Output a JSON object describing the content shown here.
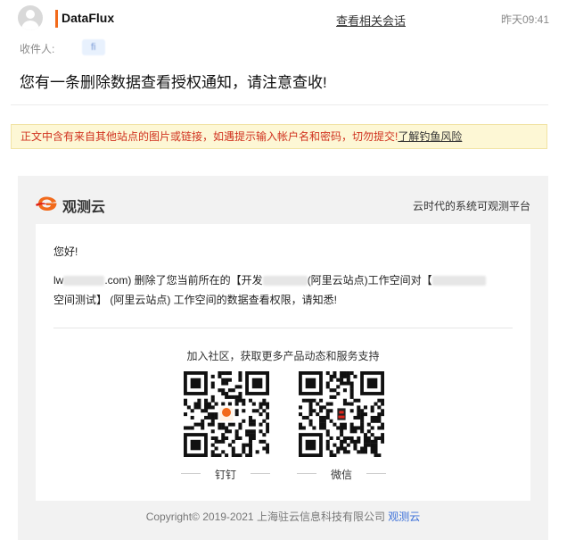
{
  "header": {
    "sender": "DataFlux",
    "related_link": "查看相关会话",
    "time": "昨天09:41",
    "recipient_label": "收件人:",
    "recipient_value": "fi"
  },
  "subject": "您有一条删除数据查看授权通知，请注意查收!",
  "warning": {
    "text": "正文中含有来自其他站点的图片或链接，如遇提示输入帐户名和密码，切勿提交!",
    "link": "了解钓鱼风险"
  },
  "card": {
    "brand_name": "观测云",
    "tagline": "云时代的系统可观测平台",
    "greeting": "您好!",
    "message": {
      "part1": "lw",
      "part2": ".com) 删除了您当前所在的【开发",
      "part3": "(阿里云站点)工作空间对【",
      "part4": "空间测试】 (阿里云站点) 工作空间的数据查看权限，请知悉!"
    },
    "community": "加入社区，获取更多产品动态和服务支持",
    "qr_codes": [
      {
        "label": "钉钉"
      },
      {
        "label": "微信"
      }
    ],
    "footer_prefix": "Copyright© 2019-2021 上海驻云信息科技有限公司 ",
    "footer_brand": "观测云"
  },
  "colors": {
    "accent": "#f26a1b",
    "warning_bg": "#fdf7d5",
    "warning_text": "#d0321f",
    "link_blue": "#3b6fd8"
  }
}
